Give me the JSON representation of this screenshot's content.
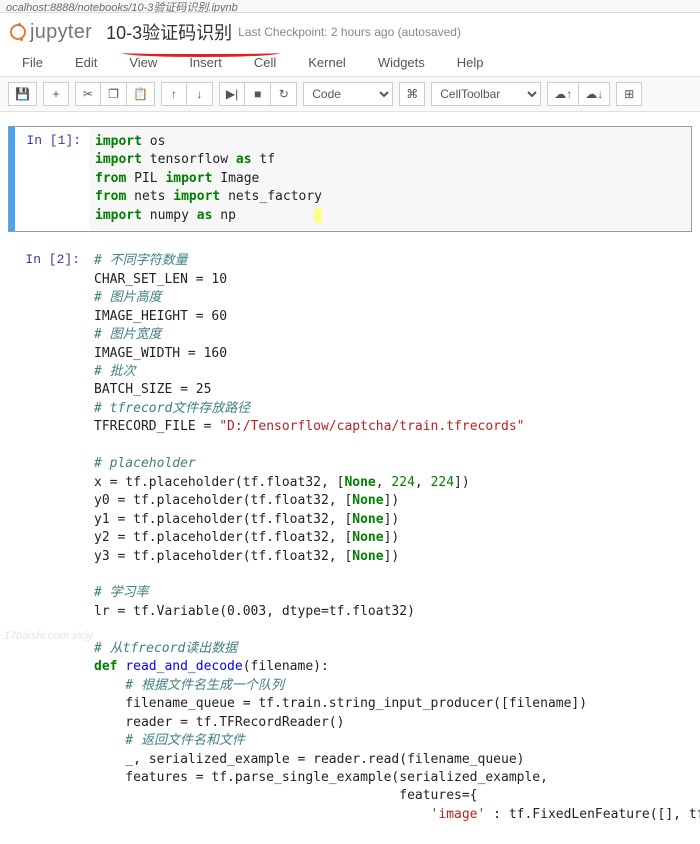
{
  "addressbar": "ocalhost:8888/notebooks/10-3验证码识别.ipynb",
  "brand": "jupyter",
  "notebook_title": "10-3验证码识别",
  "checkpoint": "Last Checkpoint: 2 hours ago (autosaved)",
  "menu": {
    "items": [
      "File",
      "Edit",
      "View",
      "Insert",
      "Cell",
      "Kernel",
      "Widgets",
      "Help"
    ]
  },
  "toolbar": {
    "save_icon": "💾",
    "add_icon": "+",
    "cut_icon": "✂",
    "copy_icon": "❐",
    "paste_icon": "📋",
    "up_icon": "↑",
    "down_icon": "↓",
    "run_icon": "▶|",
    "stop_icon": "■",
    "restart_icon": "↻",
    "celltype_selected": "Code",
    "cmd_icon": "⌘",
    "celltoolbar_selected": "CellToolbar",
    "cloud_up": "☁↑",
    "cloud_down": "☁↓",
    "grid_icon": "⊞"
  },
  "cells": {
    "c1": {
      "prompt": "In [1]:",
      "lines": {
        "l1a": "import",
        "l1b": " os",
        "l2a": "import",
        "l2b": " tensorflow ",
        "l2c": "as",
        "l2d": " tf",
        "l3a": "from",
        "l3b": " PIL ",
        "l3c": "import",
        "l3d": " Image",
        "l4a": "from",
        "l4b": " nets ",
        "l4c": "import",
        "l4d": " nets_factory",
        "l5a": "import",
        "l5b": " numpy ",
        "l5c": "as",
        "l5d": " np",
        "l5sp": "          "
      }
    },
    "c2": {
      "prompt": "In [2]:",
      "lines": {
        "c01": "# 不同字符数量",
        "c02": "CHAR_SET_LEN = 10",
        "c03": "# 图片高度",
        "c04": "IMAGE_HEIGHT = 60",
        "c05": "# 图片宽度",
        "c06": "IMAGE_WIDTH = 160",
        "c07": "# 批次",
        "c08": "BATCH_SIZE = 25",
        "c09": "# tfrecord文件存放路径",
        "c10a": "TFRECORD_FILE = ",
        "c10b": "\"D:/Tensorflow/captcha/train.tfrecords\"",
        "bl1": "",
        "c11": "# placeholder",
        "c12a": "x = tf.placeholder(tf.float32, [",
        "c12b": "None",
        "c12c": ", ",
        "c12d": "224",
        "c12e": ", ",
        "c12f": "224",
        "c12g": "])",
        "c13a": "y0 = tf.placeholder(tf.float32, [",
        "c13b": "None",
        "c13c": "])",
        "c14a": "y1 = tf.placeholder(tf.float32, [",
        "c14b": "None",
        "c14c": "])",
        "c15a": "y2 = tf.placeholder(tf.float32, [",
        "c15b": "None",
        "c15c": "])",
        "c16a": "y3 = tf.placeholder(tf.float32, [",
        "c16b": "None",
        "c16c": "])",
        "bl2": "",
        "c17": "# 学习率",
        "c18": "lr = tf.Variable(0.003, dtype=tf.float32)",
        "bl3": "",
        "c19": "# 从tfrecord读出数据",
        "c20a": "def ",
        "c20b": "read_and_decode",
        "c20c": "(filename):",
        "c21": "    # 根据文件名生成一个队列",
        "c22": "    filename_queue = tf.train.string_input_producer([filename])",
        "c23": "    reader = tf.TFRecordReader()",
        "c24": "    # 返回文件名和文件",
        "c25": "    _, serialized_example = reader.read(filename_queue)",
        "c26": "    features = tf.parse_single_example(serialized_example,",
        "c27": "                                       features={",
        "c28a": "                                           ",
        "c28b": "'image'",
        "c28c": " : tf.FixedLenFeature([], tf.string),"
      }
    }
  },
  "watermark": "17baishi.com xlcjy"
}
